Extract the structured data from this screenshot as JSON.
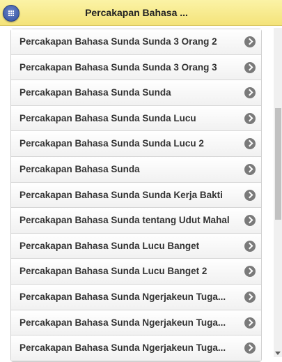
{
  "header": {
    "title": "Percakapan Bahasa ...",
    "menu_icon": "grid-icon",
    "background": "#f4e37a"
  },
  "list": {
    "items": [
      {
        "label": "Percakapan Bahasa Sunda Sunda 3 Orang 2"
      },
      {
        "label": "Percakapan Bahasa Sunda Sunda 3 Orang 3"
      },
      {
        "label": "Percakapan Bahasa Sunda Sunda"
      },
      {
        "label": "Percakapan Bahasa Sunda Sunda Lucu"
      },
      {
        "label": "Percakapan Bahasa Sunda Sunda Lucu 2"
      },
      {
        "label": "Percakapan Bahasa Sunda"
      },
      {
        "label": "Percakapan Bahasa Sunda Sunda Kerja Bakti"
      },
      {
        "label": "Percakapan Bahasa Sunda tentang Udut Mahal"
      },
      {
        "label": "Percakapan Bahasa Sunda Lucu Banget"
      },
      {
        "label": "Percakapan Bahasa Sunda Lucu Banget 2"
      },
      {
        "label": "Percakapan Bahasa Sunda Ngerjakeun Tuga..."
      },
      {
        "label": "Percakapan Bahasa Sunda Ngerjakeun Tuga..."
      },
      {
        "label": "Percakapan Bahasa Sunda Ngerjakeun Tuga..."
      }
    ],
    "arrow_icon": "chevron-right-circle-icon"
  }
}
